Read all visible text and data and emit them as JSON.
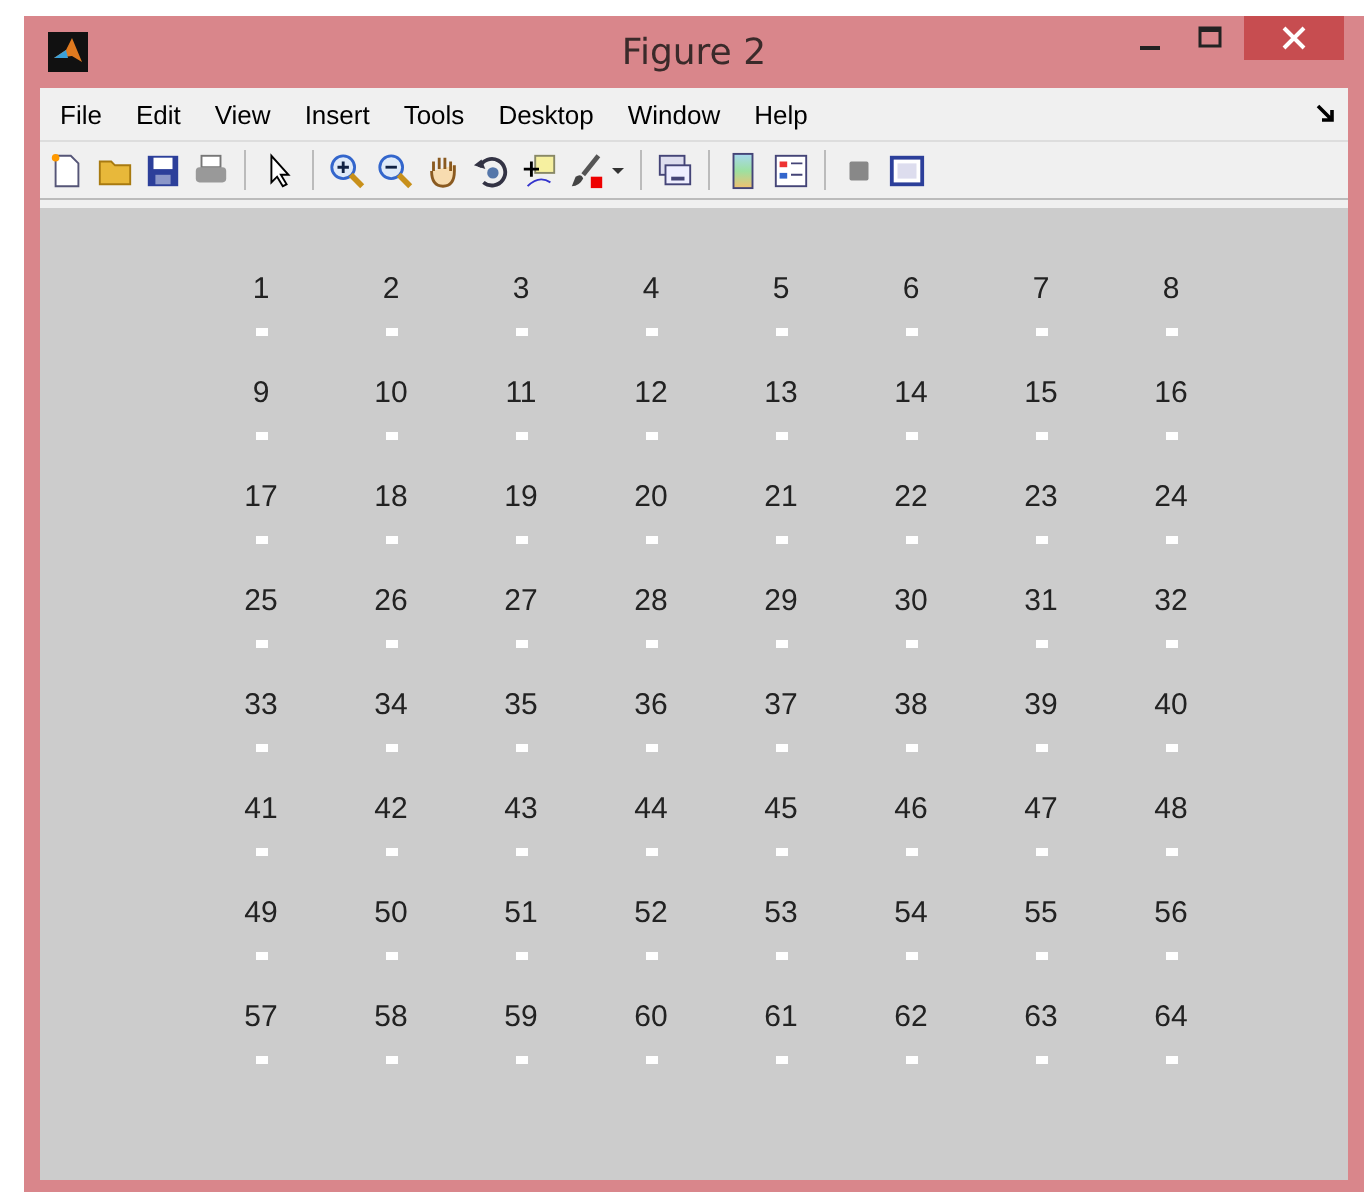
{
  "window": {
    "title": "Figure 2"
  },
  "menu": [
    "File",
    "Edit",
    "View",
    "Insert",
    "Tools",
    "Desktop",
    "Window",
    "Help"
  ],
  "cells": [
    "1",
    "2",
    "3",
    "4",
    "5",
    "6",
    "7",
    "8",
    "9",
    "10",
    "11",
    "12",
    "13",
    "14",
    "15",
    "16",
    "17",
    "18",
    "19",
    "20",
    "21",
    "22",
    "23",
    "24",
    "25",
    "26",
    "27",
    "28",
    "29",
    "30",
    "31",
    "32",
    "33",
    "34",
    "35",
    "36",
    "37",
    "38",
    "39",
    "40",
    "41",
    "42",
    "43",
    "44",
    "45",
    "46",
    "47",
    "48",
    "49",
    "50",
    "51",
    "52",
    "53",
    "54",
    "55",
    "56",
    "57",
    "58",
    "59",
    "60",
    "61",
    "62",
    "63",
    "64"
  ]
}
